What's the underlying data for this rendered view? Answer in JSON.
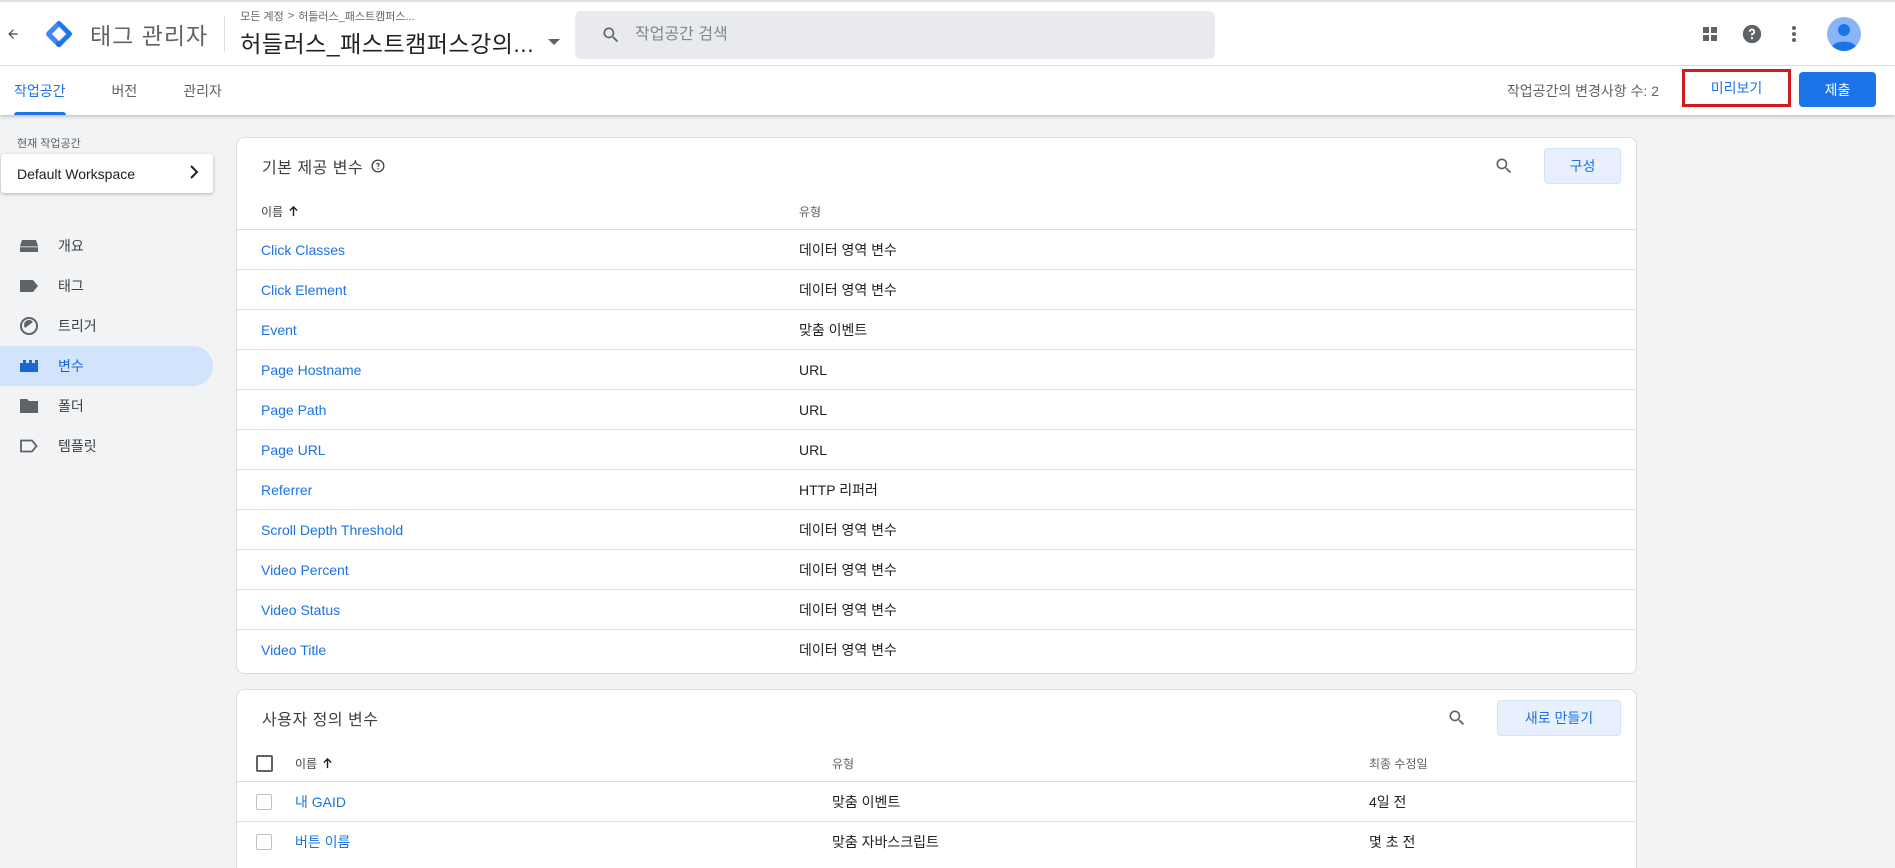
{
  "header": {
    "app_name": "태그 관리자",
    "breadcrumb_root": "모든 계정",
    "breadcrumb_sep": ">",
    "breadcrumb_account": "허들러스_패스트캠퍼스...",
    "container_name": "허들러스_패스트캠퍼스강의...",
    "search_placeholder": "작업공간 검색"
  },
  "tabs": [
    {
      "label": "작업공간",
      "active": true
    },
    {
      "label": "버전",
      "active": false
    },
    {
      "label": "관리자",
      "active": false
    }
  ],
  "toolbar": {
    "changes_label": "작업공간의 변경사항 수: 2",
    "preview_label": "미리보기",
    "submit_label": "제출"
  },
  "sidebar": {
    "workspace_label": "현재 작업공간",
    "workspace_name": "Default Workspace",
    "items": [
      {
        "label": "개요",
        "icon": "overview-icon"
      },
      {
        "label": "태그",
        "icon": "tag-icon"
      },
      {
        "label": "트리거",
        "icon": "trigger-icon"
      },
      {
        "label": "변수",
        "icon": "variable-icon",
        "active": true
      },
      {
        "label": "폴더",
        "icon": "folder-icon"
      },
      {
        "label": "템플릿",
        "icon": "template-icon"
      }
    ]
  },
  "builtin": {
    "title": "기본 제공 변수",
    "config_label": "구성",
    "col_name": "이름",
    "col_type": "유형",
    "rows": [
      {
        "name": "Click Classes",
        "type": "데이터 영역 변수"
      },
      {
        "name": "Click Element",
        "type": "데이터 영역 변수"
      },
      {
        "name": "Event",
        "type": "맞춤 이벤트"
      },
      {
        "name": "Page Hostname",
        "type": "URL"
      },
      {
        "name": "Page Path",
        "type": "URL"
      },
      {
        "name": "Page URL",
        "type": "URL"
      },
      {
        "name": "Referrer",
        "type": "HTTP 리퍼러"
      },
      {
        "name": "Scroll Depth Threshold",
        "type": "데이터 영역 변수"
      },
      {
        "name": "Video Percent",
        "type": "데이터 영역 변수"
      },
      {
        "name": "Video Status",
        "type": "데이터 영역 변수"
      },
      {
        "name": "Video Title",
        "type": "데이터 영역 변수"
      }
    ]
  },
  "user_defined": {
    "title": "사용자 정의 변수",
    "new_label": "새로 만들기",
    "col_name": "이름",
    "col_type": "유형",
    "col_modified": "최종 수정일",
    "rows": [
      {
        "name": "내 GAID",
        "type": "맞춤 이벤트",
        "modified": "4일 전"
      },
      {
        "name": "버튼 이름",
        "type": "맞춤 자바스크립트",
        "modified": "몇 초 전"
      }
    ]
  },
  "colors": {
    "accent": "#1a73e8",
    "highlight_border": "#d11a1a",
    "nav_active_bg": "#d2e3fc"
  }
}
